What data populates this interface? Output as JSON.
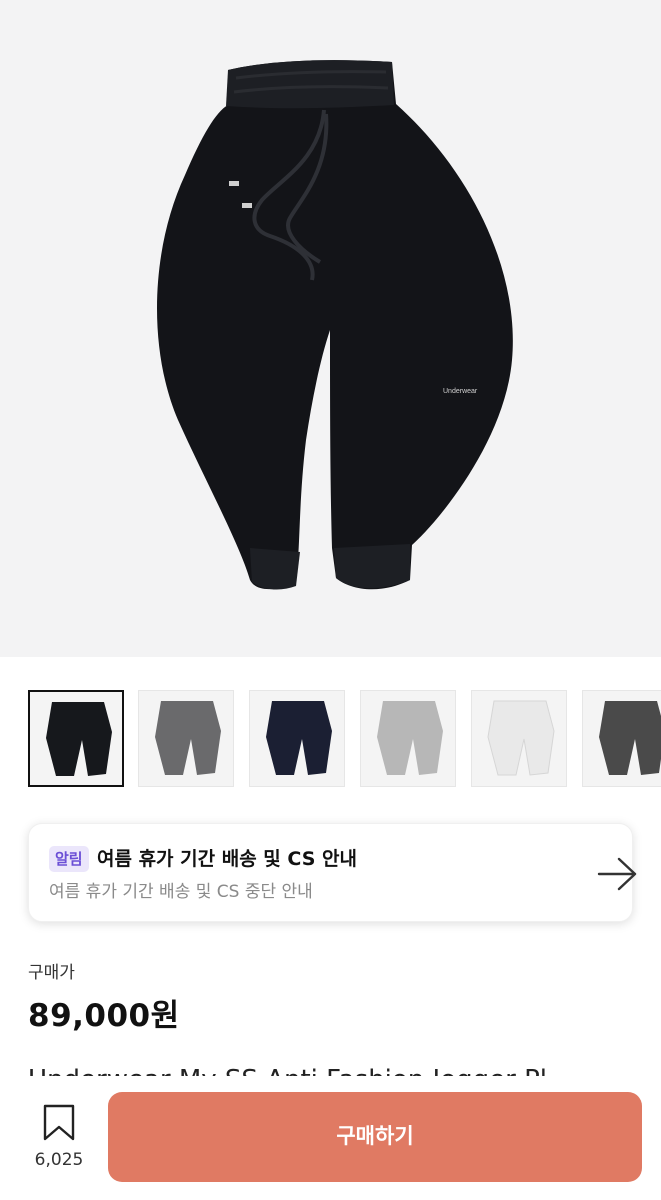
{
  "hero": {
    "image": "black-jogger-pants-photo",
    "tag_text": "Underwear"
  },
  "thumbnails": [
    {
      "color": "#16181c",
      "label": "black"
    },
    {
      "color": "#6a6a6c",
      "label": "gray"
    },
    {
      "color": "#1b1f33",
      "label": "navy"
    },
    {
      "color": "#b7b7b7",
      "label": "light-gray"
    },
    {
      "color": "#e9e9e9",
      "label": "white"
    },
    {
      "color": "#4a4a4a",
      "label": "charcoal"
    }
  ],
  "notice": {
    "badge": "알림",
    "title": "여름 휴가 기간 배송 및 CS 안내",
    "subtitle": "여름 휴가 기간 배송 및 CS 중단 안내",
    "arrow_icon": "arrow-right-icon"
  },
  "price": {
    "label": "구매가",
    "value": "89,000원"
  },
  "product_title_peek": "Underwear My SS Anti Fashion Jogger Pl",
  "bottom": {
    "bookmark_icon": "bookmark-icon",
    "bookmark_count": "6,025",
    "buy_label": "구매하기",
    "accent": "#e07a63"
  }
}
